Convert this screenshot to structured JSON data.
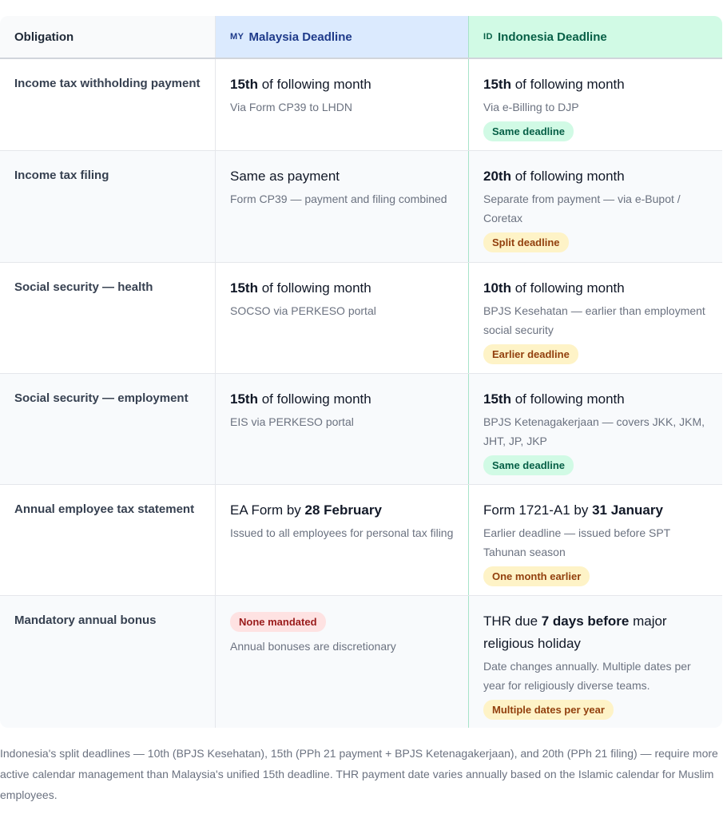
{
  "header": {
    "obligation": "Obligation",
    "my_code": "MY",
    "my_label": "Malaysia Deadline",
    "id_code": "ID",
    "id_label": "Indonesia Deadline"
  },
  "rows": [
    {
      "obligation": "Income tax withholding payment",
      "my": {
        "bold": "15th",
        "rest": " of following month",
        "sub": "Via Form CP39 to LHDN"
      },
      "id": {
        "bold": "15th",
        "rest": " of following month",
        "sub": "Via e-Billing to DJP",
        "badge": "Same deadline"
      }
    },
    {
      "obligation": "Income tax filing",
      "my": {
        "text": "Same as payment",
        "sub": "Form CP39 — payment and filing combined"
      },
      "id": {
        "bold": "20th",
        "rest": " of following month",
        "sub": "Separate from payment — via e-Bupot / Coretax",
        "badge": "Split deadline"
      }
    },
    {
      "obligation": "Social security — health",
      "my": {
        "bold": "15th",
        "rest": " of following month",
        "sub": "SOCSO via PERKESO portal"
      },
      "id": {
        "bold": "10th",
        "rest": " of following month",
        "sub": "BPJS Kesehatan — earlier than employment social security",
        "badge": "Earlier deadline"
      }
    },
    {
      "obligation": "Social security — employment",
      "my": {
        "bold": "15th",
        "rest": " of following month",
        "sub": "EIS via PERKESO portal"
      },
      "id": {
        "bold": "15th",
        "rest": " of following month",
        "sub": "BPJS Ketenagakerjaan — covers JKK, JKM, JHT, JP, JKP",
        "badge": "Same deadline"
      }
    },
    {
      "obligation": "Annual employee tax statement",
      "my": {
        "pre": "EA Form by ",
        "bold": "28 February",
        "sub": "Issued to all employees for personal tax filing"
      },
      "id": {
        "pre": "Form 1721-A1 by ",
        "bold": "31 January",
        "sub": "Earlier deadline — issued before SPT Tahunan season",
        "badge": "One month earlier"
      }
    },
    {
      "obligation": "Mandatory annual bonus",
      "my": {
        "badge": "None mandated",
        "sub": "Annual bonuses are discretionary"
      },
      "id": {
        "pre": "THR due ",
        "bold": "7 days before",
        "rest": " major religious holiday",
        "sub": "Date changes annually. Multiple dates per year for religiously diverse teams.",
        "badge": "Multiple dates per year"
      }
    }
  ],
  "footnote": "Indonesia's split deadlines — 10th (BPJS Kesehatan), 15th (PPh 21 payment + BPJS Ketenagakerjaan), and 20th (PPh 21 filing) — require more active calendar management than Malaysia's unified 15th deadline. THR payment date varies annually based on the Islamic calendar for Muslim employees."
}
